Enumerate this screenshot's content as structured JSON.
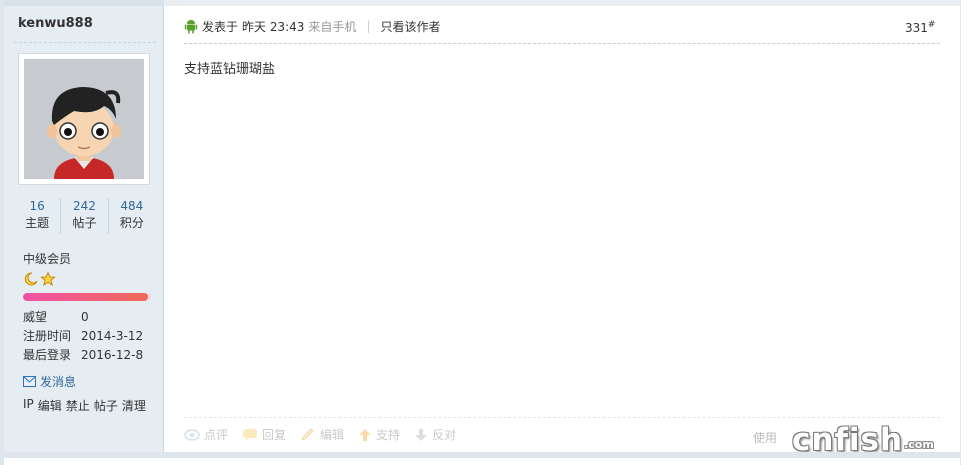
{
  "user": {
    "username": "kenwu888",
    "stats": [
      {
        "value": "16",
        "label": "主题"
      },
      {
        "value": "242",
        "label": "帖子"
      },
      {
        "value": "484",
        "label": "积分"
      }
    ],
    "group": "中级会员",
    "level_icons": [
      "moon-icon",
      "star-icon"
    ],
    "progress_fraction": 0.98,
    "info": [
      {
        "key": "威望",
        "value": "0"
      },
      {
        "key": "注册时间",
        "value": "2014-3-12"
      },
      {
        "key": "最后登录",
        "value": "2016-12-8"
      }
    ],
    "pm_label": "发消息",
    "admin_links": [
      "IP",
      "编辑",
      "禁止",
      "帖子",
      "清理"
    ]
  },
  "post": {
    "posted_prefix": "发表于",
    "time": "昨天 23:43",
    "source": "来自手机",
    "author_only": "只看该作者",
    "floor": "331",
    "floor_sup": "#",
    "content": "支持蓝钻珊瑚盐"
  },
  "actions": [
    {
      "label": "点评",
      "icon": "comment-icon"
    },
    {
      "label": "回复",
      "icon": "reply-icon"
    },
    {
      "label": "编辑",
      "icon": "edit-icon"
    },
    {
      "label": "支持",
      "icon": "up-arrow-icon"
    },
    {
      "label": "反对",
      "icon": "down-arrow-icon"
    }
  ],
  "use_text": "使用",
  "watermark": {
    "main": "cnfish",
    "suffix": ".com"
  },
  "colors": {
    "link": "#336699",
    "sidebar_bg": "#e5edf2",
    "android": "#8bc34a",
    "progress": "#f052a4"
  }
}
